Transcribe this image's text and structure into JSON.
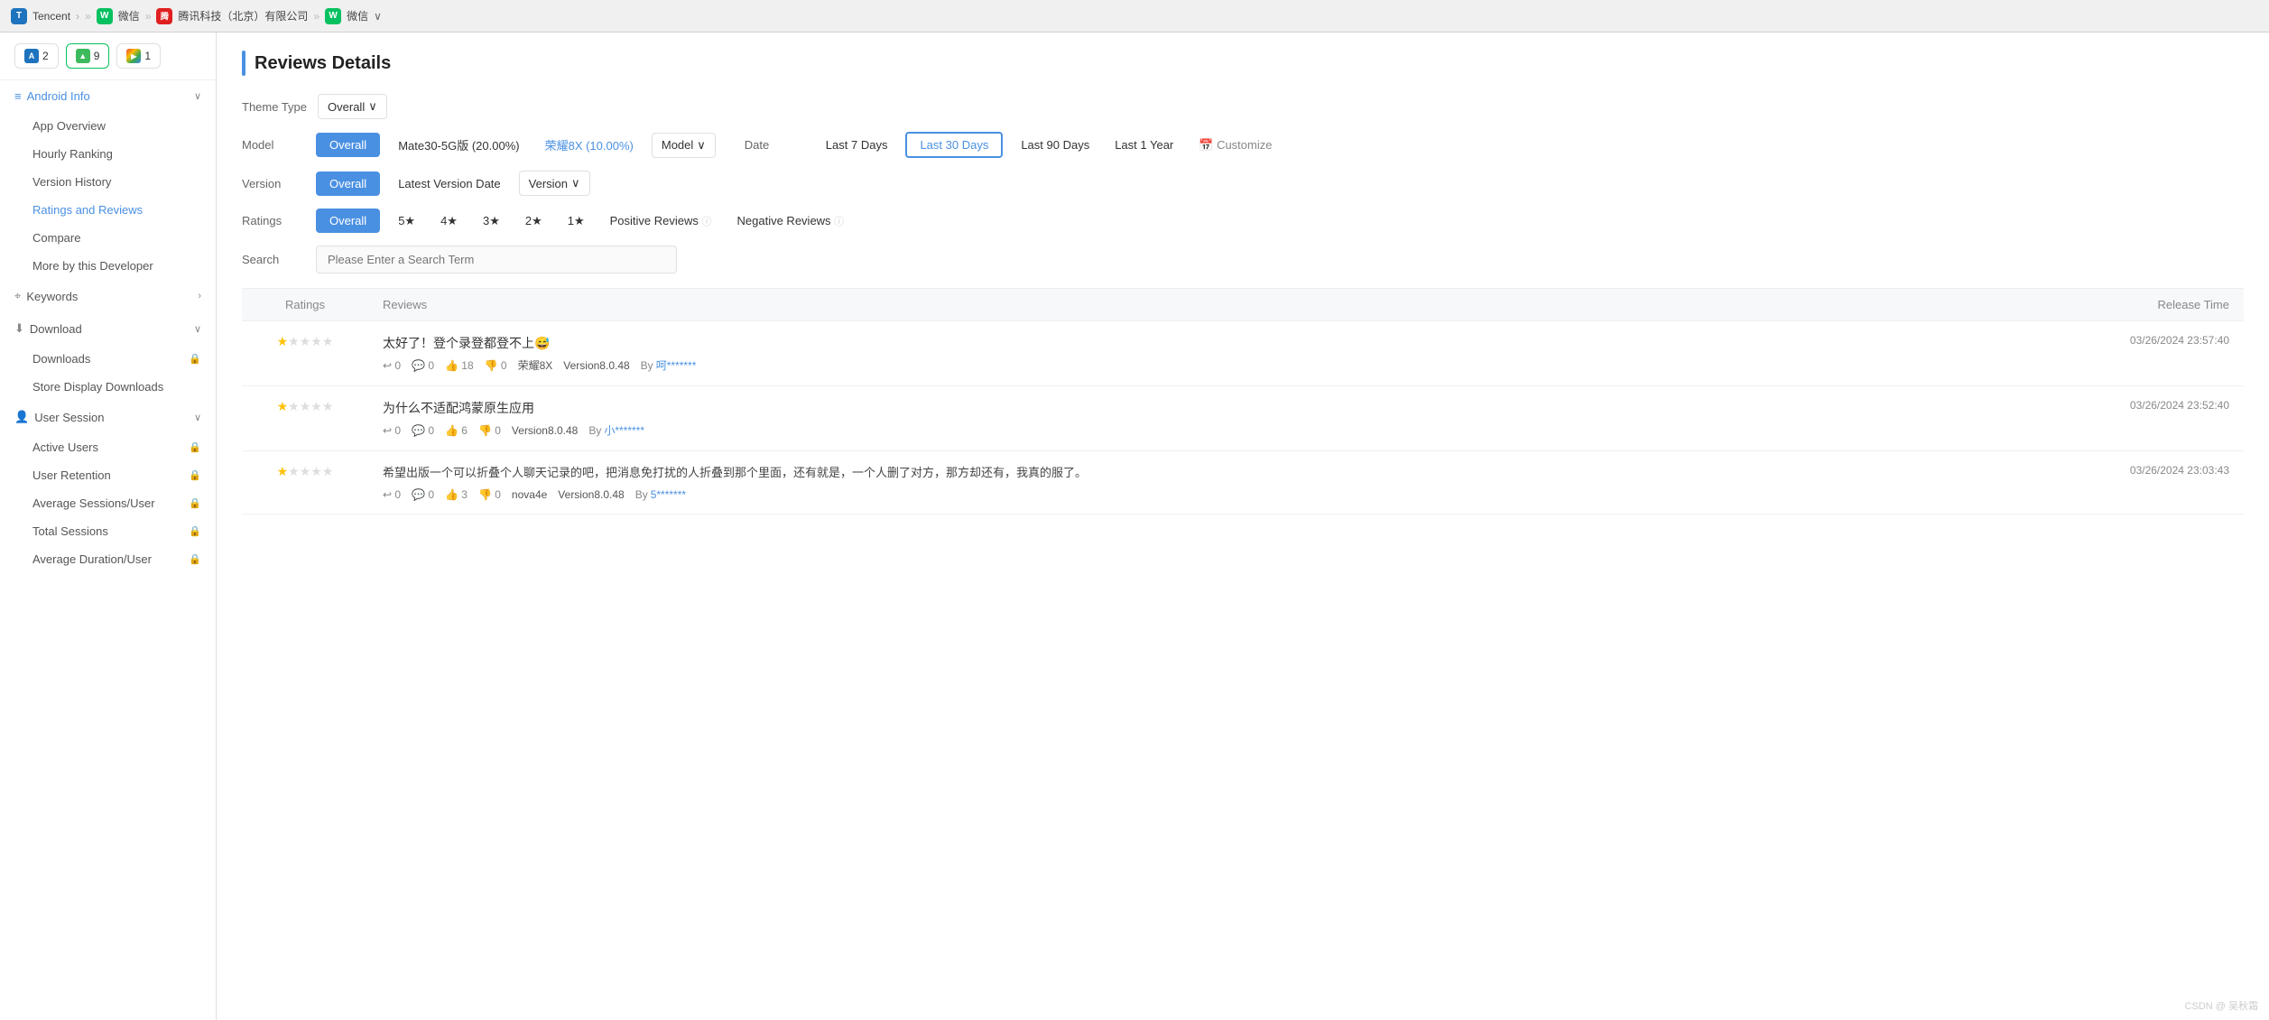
{
  "topbar": {
    "company": "Tencent",
    "sep1": "»",
    "app1_label": "微信",
    "sep2": "»",
    "sub_company": "腾讯科技（北京）有限公司",
    "sep3": "»",
    "app2_label": "微信",
    "dropdown": "∨"
  },
  "sidebar": {
    "store_buttons": [
      {
        "id": "ios",
        "label": "2",
        "type": "ios"
      },
      {
        "id": "android",
        "label": "9",
        "type": "android",
        "active": true
      },
      {
        "id": "gp",
        "label": "1",
        "type": "gp"
      }
    ],
    "sections": [
      {
        "id": "android-info",
        "label": "Android Info",
        "icon": "layers",
        "expanded": true,
        "items": [
          {
            "id": "app-overview",
            "label": "App Overview",
            "locked": false
          },
          {
            "id": "hourly-ranking",
            "label": "Hourly Ranking",
            "locked": false
          },
          {
            "id": "version-history",
            "label": "Version History",
            "locked": false
          },
          {
            "id": "ratings-reviews",
            "label": "Ratings and Reviews",
            "locked": false,
            "active": true
          },
          {
            "id": "compare",
            "label": "Compare",
            "locked": false
          },
          {
            "id": "more-by-developer",
            "label": "More by this Developer",
            "locked": false
          }
        ]
      },
      {
        "id": "keywords",
        "label": "Keywords",
        "icon": "key",
        "expanded": false,
        "items": []
      },
      {
        "id": "download",
        "label": "Download",
        "icon": "download",
        "expanded": true,
        "items": [
          {
            "id": "downloads",
            "label": "Downloads",
            "locked": true
          },
          {
            "id": "store-display-downloads",
            "label": "Store Display Downloads",
            "locked": false
          }
        ]
      },
      {
        "id": "user-session",
        "label": "User Session",
        "icon": "users",
        "expanded": true,
        "items": [
          {
            "id": "active-users",
            "label": "Active Users",
            "locked": true
          },
          {
            "id": "user-retention",
            "label": "User Retention",
            "locked": true
          },
          {
            "id": "average-sessions",
            "label": "Average Sessions/User",
            "locked": true
          },
          {
            "id": "total-sessions",
            "label": "Total Sessions",
            "locked": true
          },
          {
            "id": "average-duration",
            "label": "Average Duration/User",
            "locked": true
          }
        ]
      }
    ]
  },
  "main": {
    "title": "Reviews Details",
    "filters": {
      "theme_type_label": "Theme Type",
      "theme_type_value": "Overall",
      "model_label": "Model",
      "model_options": [
        {
          "id": "overall",
          "label": "Overall",
          "selected": true
        },
        {
          "id": "mate30",
          "label": "Mate30-5G版 (20.00%)",
          "selected": false
        },
        {
          "id": "rongYao8x",
          "label": "荣耀8X (10.00%)",
          "selected": false,
          "highlight": true
        },
        {
          "id": "model-dd",
          "label": "Model",
          "dropdown": true
        }
      ],
      "date_label": "Date",
      "date_options": [
        {
          "id": "last7",
          "label": "Last 7 Days",
          "selected": false
        },
        {
          "id": "last30",
          "label": "Last 30 Days",
          "selected": true
        },
        {
          "id": "last90",
          "label": "Last 90 Days",
          "selected": false
        },
        {
          "id": "last1year",
          "label": "Last 1 Year",
          "selected": false
        },
        {
          "id": "customize",
          "label": "Customize",
          "calendar": true
        }
      ],
      "version_label": "Version",
      "version_options": [
        {
          "id": "overall",
          "label": "Overall",
          "selected": true
        },
        {
          "id": "latest",
          "label": "Latest Version Date",
          "selected": false
        },
        {
          "id": "version-dd",
          "label": "Version",
          "dropdown": true
        }
      ],
      "ratings_label": "Ratings",
      "ratings_options": [
        {
          "id": "overall",
          "label": "Overall",
          "selected": true
        },
        {
          "id": "5star",
          "label": "5★",
          "selected": false
        },
        {
          "id": "4star",
          "label": "4★",
          "selected": false
        },
        {
          "id": "3star",
          "label": "3★",
          "selected": false
        },
        {
          "id": "2star",
          "label": "2★",
          "selected": false
        },
        {
          "id": "1star",
          "label": "1★",
          "selected": false
        },
        {
          "id": "positive",
          "label": "Positive Reviews",
          "selected": false
        },
        {
          "id": "negative",
          "label": "Negative Reviews",
          "selected": false
        }
      ]
    },
    "search_placeholder": "Please Enter a Search Term",
    "table": {
      "headers": {
        "ratings": "Ratings",
        "reviews": "Reviews",
        "release_time": "Release Time"
      },
      "rows": [
        {
          "id": "row1",
          "rating": 1,
          "max_rating": 5,
          "review_title": "太好了！登个录登都登不上😅",
          "meta": {
            "reply": "0",
            "comment": "0",
            "like": "18",
            "dislike": "0",
            "device": "荣耀8X",
            "version": "Version8.0.48",
            "by_prefix": "By",
            "author": "呵*******"
          },
          "release_time": "03/26/2024 23:57:40"
        },
        {
          "id": "row2",
          "rating": 1,
          "max_rating": 5,
          "review_title": "为什么不适配鸿蒙原生应用",
          "meta": {
            "reply": "0",
            "comment": "0",
            "like": "6",
            "dislike": "0",
            "device": "",
            "version": "Version8.0.48",
            "by_prefix": "By",
            "author": "小*******"
          },
          "release_time": "03/26/2024 23:52:40"
        },
        {
          "id": "row3",
          "rating": 1,
          "max_rating": 5,
          "review_title": "",
          "review_content": "希望出版一个可以折叠个人聊天记录的吧，把消息免打扰的人折叠到那个里面，还有就是，一个人删了对方，那方却还有，我真的服了。",
          "meta": {
            "reply": "0",
            "comment": "0",
            "like": "3",
            "dislike": "0",
            "device": "nova4e",
            "version": "Version8.0.48",
            "by_prefix": "By",
            "author": "5*******"
          },
          "release_time": "03/26/2024 23:03:43"
        }
      ]
    }
  },
  "watermark": "CSDN @ 吴秋霜"
}
